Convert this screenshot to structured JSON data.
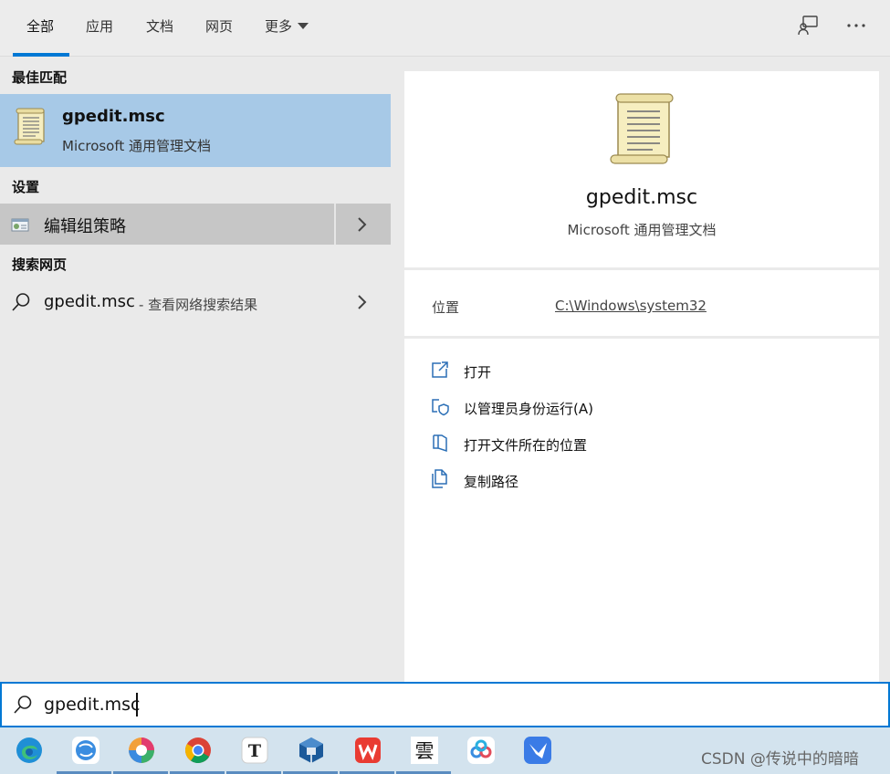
{
  "tabs": {
    "all": "全部",
    "apps": "应用",
    "docs": "文档",
    "web": "网页",
    "more": "更多"
  },
  "left": {
    "best_match_header": "最佳匹配",
    "best_match": {
      "name": "gpedit.msc",
      "subtitle": "Microsoft 通用管理文档"
    },
    "settings_header": "设置",
    "settings_item": "编辑组策略",
    "web_header": "搜索网页",
    "web_item": {
      "query": "gpedit.msc",
      "hint": "- 查看网络搜索结果"
    }
  },
  "right": {
    "title": "gpedit.msc",
    "subtitle": "Microsoft 通用管理文档",
    "location_label": "位置",
    "location_value": "C:\\Windows\\system32",
    "actions": [
      {
        "label": "打开",
        "icon": "open-icon"
      },
      {
        "label": "以管理员身份运行(A)",
        "icon": "shield-icon"
      },
      {
        "label": "打开文件所在的位置",
        "icon": "file-location-icon"
      },
      {
        "label": "复制路径",
        "icon": "copy-icon"
      }
    ]
  },
  "search": {
    "value": "gpedit.msc"
  },
  "taskbar": {
    "apps": [
      "edge-icon",
      "browser-icon",
      "color-wheel-icon",
      "chrome-icon",
      "typora-icon",
      "virtualbox-icon",
      "wps-icon",
      "cloud-char-icon",
      "baidu-netdisk-icon",
      "feishu-icon"
    ],
    "tile_char": "雲",
    "typora_char": "T",
    "watermark": "CSDN @传说中的暗暗"
  },
  "colors": {
    "accent": "#0078d4",
    "selection": "#a7c9e7",
    "settings_highlight": "#c6c6c6"
  }
}
